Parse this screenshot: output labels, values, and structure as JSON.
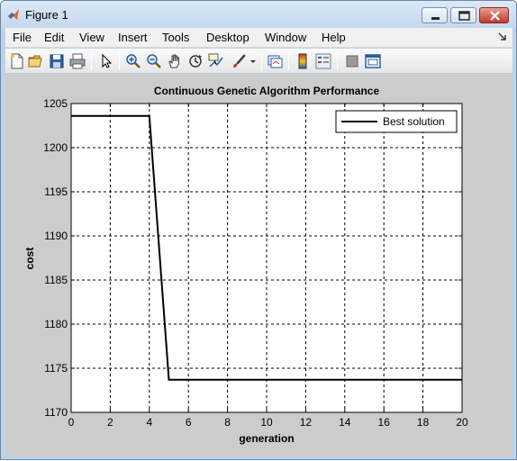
{
  "window": {
    "title": "Figure 1"
  },
  "menu": {
    "items": [
      {
        "label": "File"
      },
      {
        "label": "Edit"
      },
      {
        "label": "View"
      },
      {
        "label": "Insert"
      },
      {
        "label": "Tools"
      },
      {
        "label": "Desktop"
      },
      {
        "label": "Window"
      },
      {
        "label": "Help"
      }
    ]
  },
  "toolbar": {
    "tools": [
      "new-figure-icon",
      "open-file-icon",
      "save-icon",
      "print-icon",
      "edit-plot-arrow-icon",
      "zoom-in-icon",
      "zoom-out-icon",
      "pan-hand-icon",
      "rotate-3d-icon",
      "data-cursor-icon",
      "brush-icon",
      "link-plot-icon",
      "colorbar-icon",
      "legend-icon",
      "hide-plot-tools-icon",
      "show-plot-tools-icon"
    ]
  },
  "chart_data": {
    "type": "line",
    "title": "Continuous Genetic Algorithm Performance",
    "xlabel": "generation",
    "ylabel": "cost",
    "xlim": [
      0,
      20
    ],
    "ylim": [
      1170,
      1205
    ],
    "xticks": [
      0,
      2,
      4,
      6,
      8,
      10,
      12,
      14,
      16,
      18,
      20
    ],
    "yticks": [
      1170,
      1175,
      1180,
      1185,
      1190,
      1195,
      1200,
      1205
    ],
    "grid": true,
    "legend_position": "top-right",
    "series": [
      {
        "name": "Best solution",
        "color": "#000000",
        "x": [
          0,
          1,
          2,
          3,
          4,
          5,
          6,
          7,
          8,
          9,
          10,
          11,
          12,
          13,
          14,
          15,
          16,
          17,
          18,
          19,
          20
        ],
        "y": [
          1203.6,
          1203.6,
          1203.6,
          1203.6,
          1203.6,
          1173.7,
          1173.7,
          1173.7,
          1173.7,
          1173.7,
          1173.7,
          1173.7,
          1173.7,
          1173.7,
          1173.7,
          1173.7,
          1173.7,
          1173.7,
          1173.7,
          1173.7,
          1173.7
        ]
      }
    ]
  }
}
